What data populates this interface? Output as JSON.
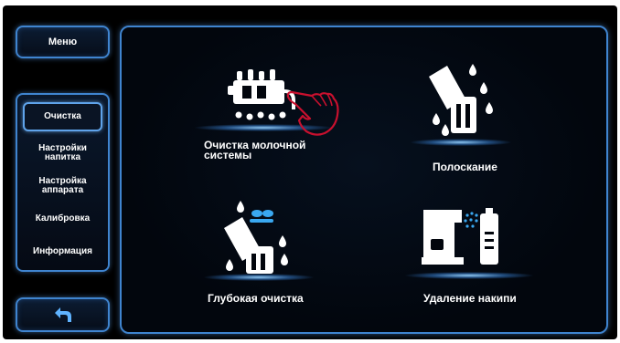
{
  "header": {
    "menu_label": "Меню"
  },
  "sidebar": {
    "items": [
      {
        "label": "Очистка",
        "active": true
      },
      {
        "label": "Настройки\nнапитка",
        "active": false
      },
      {
        "label": "Настройка\nаппарата",
        "active": false
      },
      {
        "label": "Калибровка",
        "active": false
      },
      {
        "label": "Информация",
        "active": false
      }
    ]
  },
  "tiles": [
    {
      "label": "Очистка молочной\nсистемы",
      "icon": "milk-system-cleaning-icon"
    },
    {
      "label": "Полоскание",
      "icon": "rinse-icon"
    },
    {
      "label": "Глубокая очистка",
      "icon": "deep-cleaning-icon"
    },
    {
      "label": "Удаление накипи",
      "icon": "descaling-icon"
    }
  ],
  "back_button": {
    "icon": "back-arrow-icon"
  },
  "overlay": {
    "icon": "pointing-hand-icon"
  },
  "colors": {
    "accent": "#3f84cf",
    "icon_white": "#ffffff",
    "glow": "#8fd0ff",
    "hand": "#c8102e"
  }
}
